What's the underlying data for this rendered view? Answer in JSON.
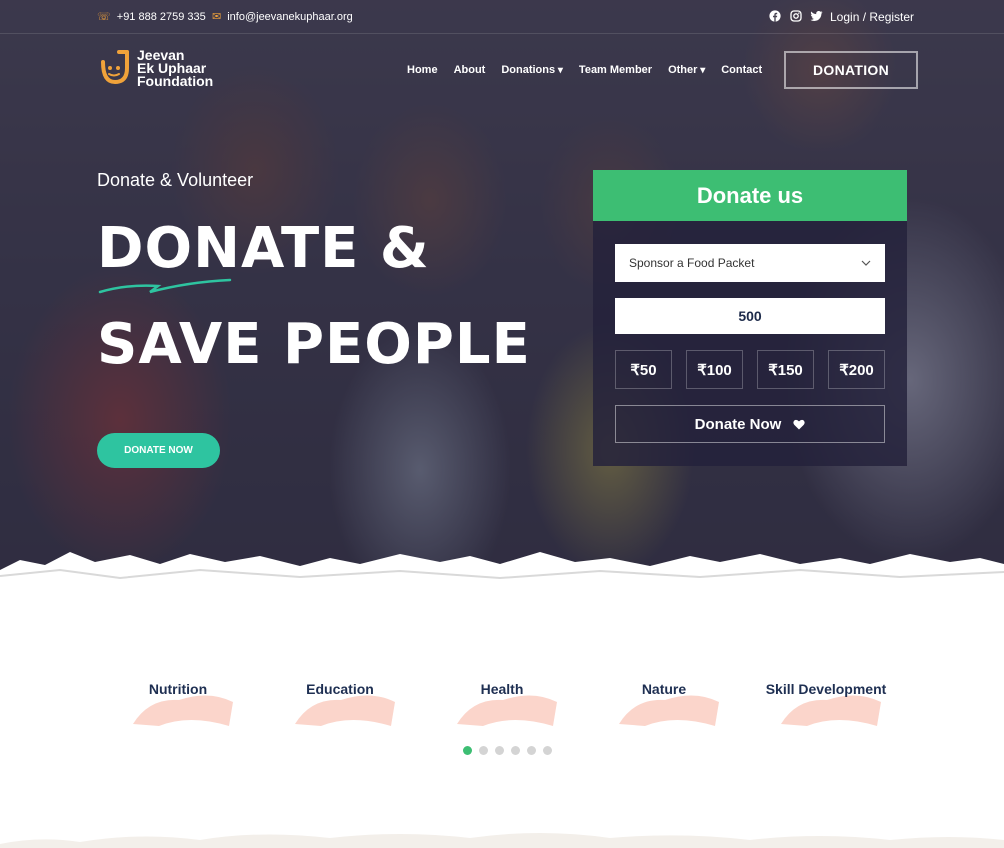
{
  "topbar": {
    "phone": "+91 888 2759 335",
    "email": "info@jeevanekuphaar.org",
    "social_icons": [
      "facebook-icon",
      "instagram-icon",
      "twitter-icon"
    ],
    "login": "Login / Register"
  },
  "brand": {
    "line1": "Jeevan",
    "line2": "Ek Uphaar",
    "line3": "Foundation",
    "accent": "#f0a23a"
  },
  "nav": {
    "items": [
      "Home",
      "About",
      "Donations",
      "Team Member",
      "Other",
      "Contact"
    ],
    "cta": "DONATION"
  },
  "hero": {
    "subtitle": "Donate & Volunteer",
    "title_line1": "DONATE &",
    "title_line2": "SAVE PEOPLE",
    "cta": "DONATE NOW",
    "cta_color": "#2ec4a0"
  },
  "donate_panel": {
    "title": "Donate us",
    "header_color": "#3dbe73",
    "select_value": "Sponsor a Food Packet",
    "amount_value": "500",
    "preset_amounts": [
      "₹50",
      "₹100",
      "₹150",
      "₹200"
    ],
    "submit": "Donate Now"
  },
  "categories": [
    "Nutrition",
    "Education",
    "Health",
    "Nature",
    "Skill Development"
  ],
  "carousel": {
    "dot_count": 6,
    "active": 1
  }
}
